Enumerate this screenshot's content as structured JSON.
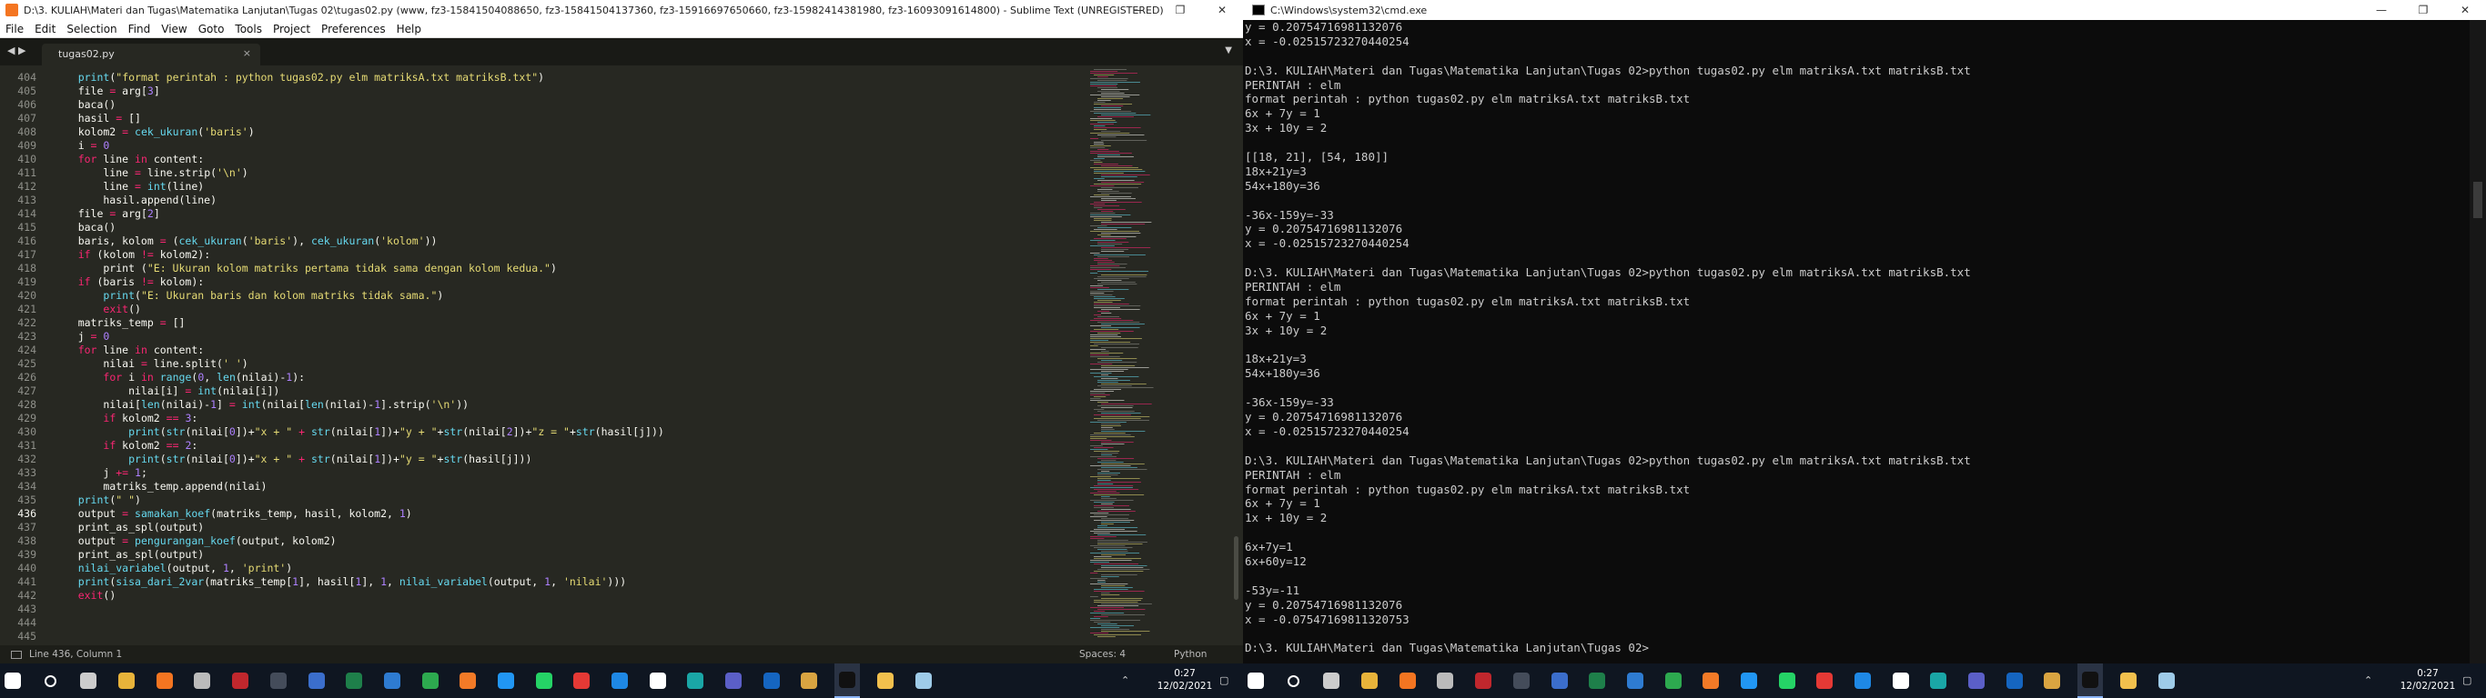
{
  "sublime": {
    "title": "D:\\3. KULIAH\\Materi dan Tugas\\Matematika Lanjutan\\Tugas 02\\tugas02.py (www, fz3-15841504088650, fz3-15841504137360, fz3-15916697650660, fz3-15982414381980, fz3-16093091614800) - Sublime Text (UNREGISTERED)",
    "menu": [
      "File",
      "Edit",
      "Selection",
      "Find",
      "View",
      "Goto",
      "Tools",
      "Project",
      "Preferences",
      "Help"
    ],
    "nav_arrows": "◀ ▶",
    "tab_name": "tugas02.py",
    "tab_close": "×",
    "tab_dropdown": "▼",
    "line_numbers": [
      "404",
      "405",
      "406",
      "407",
      "408",
      "409",
      "410",
      "411",
      "412",
      "413",
      "414",
      "415",
      "416",
      "417",
      "418",
      "419",
      "420",
      "421",
      "422",
      "423",
      "424",
      "425",
      "426",
      "427",
      "428",
      "429",
      "430",
      "431",
      "432",
      "433",
      "434",
      "435",
      "436",
      "437",
      "438",
      "439",
      "440",
      "441",
      "442",
      "443",
      "444",
      "445"
    ],
    "code_lines": [
      "    print(\"format perintah : python tugas02.py elm matriksA.txt matriksB.txt\")",
      "    file = arg[3]",
      "    baca()",
      "    hasil = []",
      "    kolom2 = cek_ukuran('baris')",
      "    i = 0",
      "    for line in content:",
      "        line = line.strip('\\n')",
      "        line = int(line)",
      "        hasil.append(line)",
      "    file = arg[2]",
      "    baca()",
      "    baris, kolom = (cek_ukuran('baris'), cek_ukuran('kolom'))",
      "    if (kolom != kolom2):",
      "        print (\"E: Ukuran kolom matriks pertama tidak sama dengan kolom kedua.\")",
      "    if (baris != kolom):",
      "        print(\"E: Ukuran baris dan kolom matriks tidak sama.\")",
      "        exit()",
      "    matriks_temp = []",
      "    j = 0",
      "    for line in content:",
      "        nilai = line.split(' ')",
      "        for i in range(0, len(nilai)-1):",
      "            nilai[i] = int(nilai[i])",
      "        nilai[len(nilai)-1] = int(nilai[len(nilai)-1].strip('\\n'))",
      "        if kolom2 == 3:",
      "            print(str(nilai[0])+\"x + \" + str(nilai[1])+\"y + \"+str(nilai[2])+\"z = \"+str(hasil[j]))",
      "        if kolom2 == 2:",
      "            print(str(nilai[0])+\"x + \" + str(nilai[1])+\"y = \"+str(hasil[j]))",
      "        j += 1;",
      "        matriks_temp.append(nilai)",
      "    print(\" \")",
      "    output = samakan_koef(matriks_temp, hasil, kolom2, 1)",
      "    print_as_spl(output)",
      "    output = pengurangan_koef(output, kolom2)",
      "    print_as_spl(output)",
      "    nilai_variabel(output, 1, 'print')",
      "    print(sisa_dari_2var(matriks_temp[1], hasil[1], 1, nilai_variabel(output, 1, 'nilai')))",
      "    exit()",
      "",
      "",
      ""
    ],
    "status": {
      "position": "Line 436, Column 1",
      "spaces": "Spaces: 4",
      "language": "Python"
    }
  },
  "cmd": {
    "title": "C:\\Windows\\system32\\cmd.exe",
    "lines": [
      "y = 0.20754716981132076",
      "x = -0.02515723270440254",
      "",
      "D:\\3. KULIAH\\Materi dan Tugas\\Matematika Lanjutan\\Tugas 02>python tugas02.py elm matriksA.txt matriksB.txt",
      "PERINTAH : elm",
      "format perintah : python tugas02.py elm matriksA.txt matriksB.txt",
      "6x + 7y = 1",
      "3x + 10y = 2",
      "",
      "[[18, 21], [54, 180]]",
      "18x+21y=3",
      "54x+180y=36",
      "",
      "-36x-159y=-33",
      "y = 0.20754716981132076",
      "x = -0.02515723270440254",
      "",
      "D:\\3. KULIAH\\Materi dan Tugas\\Matematika Lanjutan\\Tugas 02>python tugas02.py elm matriksA.txt matriksB.txt",
      "PERINTAH : elm",
      "format perintah : python tugas02.py elm matriksA.txt matriksB.txt",
      "6x + 7y = 1",
      "3x + 10y = 2",
      "",
      "18x+21y=3",
      "54x+180y=36",
      "",
      "-36x-159y=-33",
      "y = 0.20754716981132076",
      "x = -0.02515723270440254",
      "",
      "D:\\3. KULIAH\\Materi dan Tugas\\Matematika Lanjutan\\Tugas 02>python tugas02.py elm matriksA.txt matriksB.txt",
      "PERINTAH : elm",
      "format perintah : python tugas02.py elm matriksA.txt matriksB.txt",
      "6x + 7y = 1",
      "1x + 10y = 2",
      "",
      "6x+7y=1",
      "6x+60y=12",
      "",
      "-53y=-11",
      "y = 0.20754716981132076",
      "x = -0.07547169811320753",
      "",
      "D:\\3. KULIAH\\Materi dan Tugas\\Matematika Lanjutan\\Tugas 02>"
    ]
  },
  "taskbar_left": {
    "time": "0:27",
    "date": "12/02/2021",
    "icons": [
      "windows-icon",
      "search-icon",
      "task-view-icon",
      "file-explorer-icon",
      "sublime-text-icon",
      "settings-icon",
      "filezilla-icon",
      "terminal-icon",
      "network-icon",
      "steam-icon",
      "vscode-icon",
      "chrome-icon",
      "firefox-icon",
      "teams-meet-icon",
      "whatsapp-icon",
      "anydesk-icon",
      "mail-icon",
      "notion-icon",
      "bip-icon",
      "microsoft-teams-icon",
      "isis-icon",
      "edge-icon",
      "cmd-icon",
      "folder-icon",
      "notes-icon"
    ],
    "icon_colors": [
      "#ffffff",
      "#ffffff",
      "#cccccc",
      "#e8b33a",
      "#f47521",
      "#bbbbbb",
      "#c0272d",
      "#444c5a",
      "#3b6ecc",
      "#1e7f4a",
      "#2e7bd1",
      "#2da94f",
      "#f27a27",
      "#2196f3",
      "#25d366",
      "#e53935",
      "#1e88e5",
      "#ffffff",
      "#1aa6a6",
      "#5b5fc7",
      "#1565c0",
      "#d9a441",
      "#111111",
      "#f2c04d",
      "#9ecbe8"
    ]
  },
  "taskbar_right": {
    "time": "0:27",
    "date": "12/02/2021"
  }
}
